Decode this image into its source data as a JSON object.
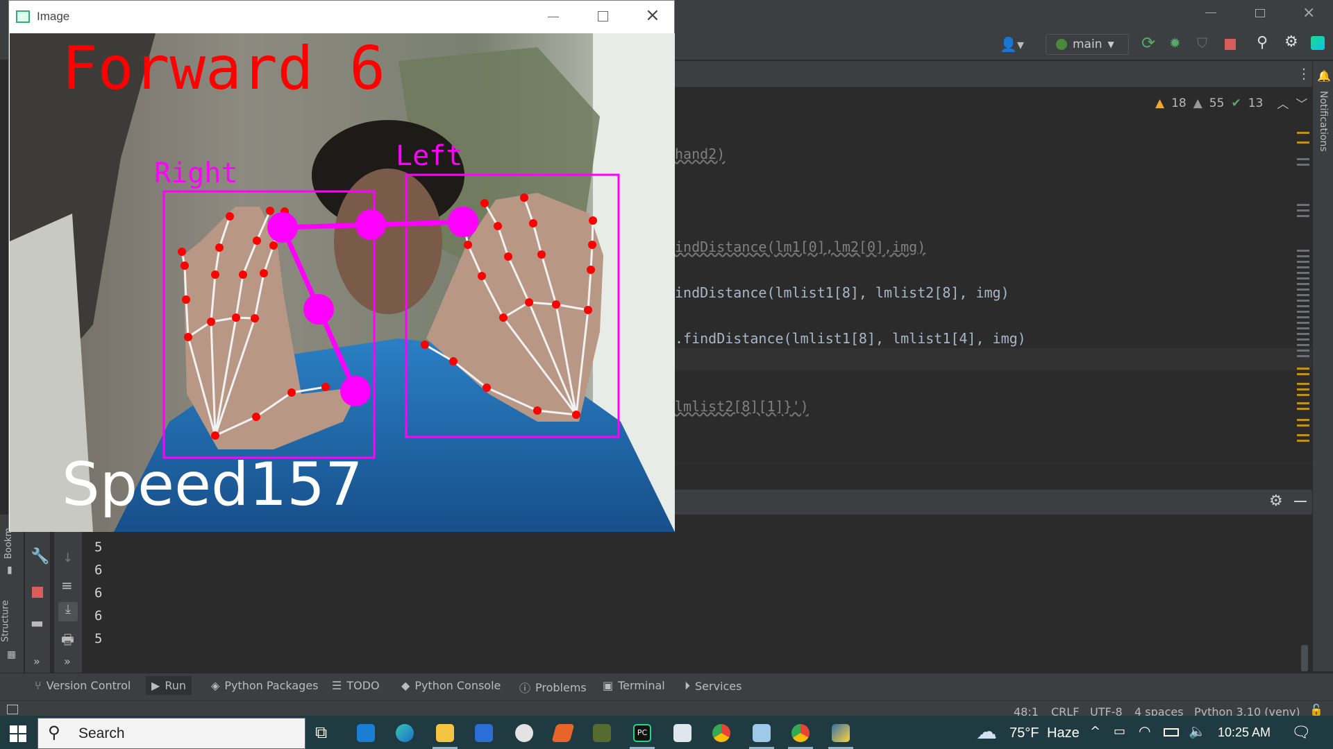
{
  "ide": {
    "branch": "main",
    "warnings": {
      "a": "18",
      "b": "55",
      "c": "13"
    },
    "notifications_label": "Notifications",
    "code_lines": [
      {
        "text": "hand2)",
        "style": "u"
      },
      {
        "text": "indDistance(lm1[0],lm2[0],img)",
        "style": "u"
      },
      {
        "text": "indDistance(lmlist1[8], lmlist2[8], img)",
        "style": "n"
      },
      {
        "text": ".findDistance(lmlist1[8], lmlist1[4], img)",
        "style": "n"
      },
      {
        "text": "lmlist2[8][1]}')",
        "style": "u"
      }
    ],
    "run_output": [
      "5",
      "6",
      "6",
      "6",
      "5"
    ],
    "left_labels": {
      "bookmarks": "Bookm",
      "structure": "Structure"
    },
    "tool_tabs": [
      {
        "label": "Version Control",
        "icon": "branch-icon"
      },
      {
        "label": "Run",
        "icon": "play-icon"
      },
      {
        "label": "Python Packages",
        "icon": "layers-icon"
      },
      {
        "label": "TODO",
        "icon": "list-icon"
      },
      {
        "label": "Python Console",
        "icon": "python-icon"
      },
      {
        "label": "Problems",
        "icon": "info-icon"
      },
      {
        "label": "Terminal",
        "icon": "terminal-icon"
      },
      {
        "label": "Services",
        "icon": "services-icon"
      }
    ],
    "status": {
      "position": "48:1",
      "line_sep": "CRLF",
      "encoding": "UTF-8",
      "indent": "4 spaces",
      "interpreter": "Python 3.10 (venv)"
    }
  },
  "image_window": {
    "title": "Image",
    "overlay_title": "Forward 6",
    "overlay_speed": "Speed157",
    "label_right": "Right",
    "label_left": "Left",
    "colors": {
      "red": "#ff0000",
      "magenta": "#ff00ff",
      "white": "#ffffff"
    }
  },
  "taskbar": {
    "search_placeholder": "Search",
    "weather_temp": "75°F",
    "weather_desc": "Haze",
    "time": "10:25 AM"
  }
}
